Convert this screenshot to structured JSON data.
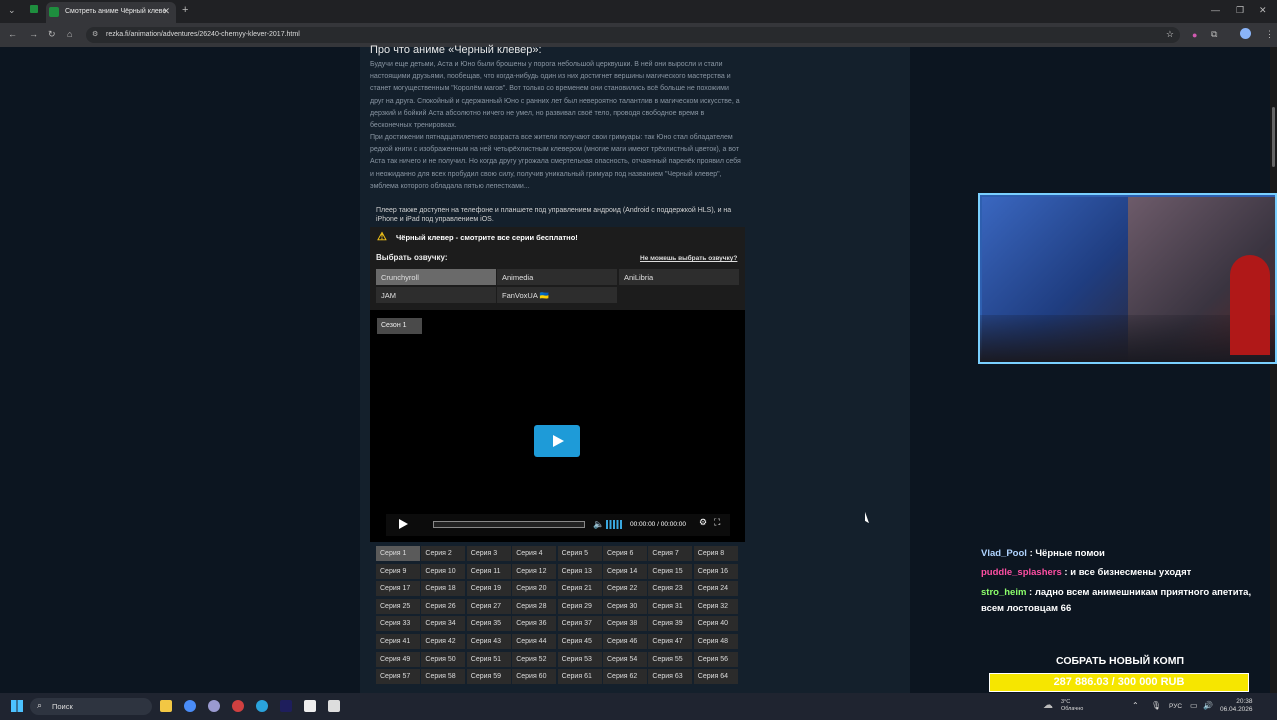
{
  "browser": {
    "tab_title": "Смотреть аниме Чёрный клеве",
    "url": "rezka.fi/animation/adventures/26240-chernyy-klever-2017.html"
  },
  "page": {
    "heading": "Про что аниме «Черный клевер»:",
    "description_1": "Будучи еще детьми, Аста и Юно были брошены у порога небольшой церквушки. В ней они выросли и стали настоящими друзьями, пообещав, что когда-нибудь один из них достигнет вершины магического мастерства и станет могущественным \"Королём магов\". Вот только со временем они становились всё больше не похожими друг на друга. Спокойный и сдержанный Юно с ранних лет был невероятно талантлив в магическом искусстве, а дерзкий и бойкий Аста абсолютно ничего не умел, но развивал своё тело, проводя свободное время в бесконечных тренировках.",
    "description_2": "При достижении пятнадцатилетнего возраста все жители получают свои гримуары: так Юно стал обладателем редкой книги с изображенным на ней четырёхлистным клевером (многие маги имеют трёхлистный цветок), а вот Аста так ничего и не получил. Но когда другу угрожала смертельная опасность, отчаянный паренёк проявил себя и неожиданно для всех пробудил свою силу, получив уникальный гримуар под названием \"Черный клевер\", эмблема которого обладала пятью лепестками...",
    "notice": "Плеер также доступен на телефоне и планшете под управлением андроид (Android с поддержкой HLS), и на iPhone и iPad под управлением iOS.",
    "warning": "Чёрный клевер - смотрите все серии бесплатно!",
    "voice_label": "Выбрать озвучку:",
    "voice_help": "Не можешь выбрать озвучку?",
    "voices": [
      "Crunchyroll",
      "Animedia",
      "AniLibria",
      "JAM",
      "FanVoxUA 🇺🇦"
    ],
    "season": "Сезон 1",
    "time": "00:00:00 / 00:00:00",
    "episodes": [
      "Серия 1",
      "Серия 2",
      "Серия 3",
      "Серия 4",
      "Серия 5",
      "Серия 6",
      "Серия 7",
      "Серия 8",
      "Серия 9",
      "Серия 10",
      "Серия 11",
      "Серия 12",
      "Серия 13",
      "Серия 14",
      "Серия 15",
      "Серия 16",
      "Серия 17",
      "Серия 18",
      "Серия 19",
      "Серия 20",
      "Серия 21",
      "Серия 22",
      "Серия 23",
      "Серия 24",
      "Серия 25",
      "Серия 26",
      "Серия 27",
      "Серия 28",
      "Серия 29",
      "Серия 30",
      "Серия 31",
      "Серия 32",
      "Серия 33",
      "Серия 34",
      "Серия 35",
      "Серия 36",
      "Серия 37",
      "Серия 38",
      "Серия 39",
      "Серия 40",
      "Серия 41",
      "Серия 42",
      "Серия 43",
      "Серия 44",
      "Серия 45",
      "Серия 46",
      "Серия 47",
      "Серия 48",
      "Серия 49",
      "Серия 50",
      "Серия 51",
      "Серия 52",
      "Серия 53",
      "Серия 54",
      "Серия 55",
      "Серия 56",
      "Серия 57",
      "Серия 58",
      "Серия 59",
      "Серия 60",
      "Серия 61",
      "Серия 62",
      "Серия 63",
      "Серия 64"
    ]
  },
  "stream": {
    "chat": [
      {
        "user": "Vlad_Pool",
        "user_color": "#b0d4ff",
        "text": " : Чёрные помои"
      },
      {
        "user": "puddle_splashers",
        "user_color": "#ff4fa3",
        "text": " : и все бизнесмены уходят"
      },
      {
        "user": "stro_heim",
        "user_color": "#8cff6b",
        "text": " : ладно всем анимешникам приятного апетита,"
      },
      {
        "user": "",
        "user_color": "#ffffff",
        "text": "всем лостовцам 66"
      }
    ],
    "donate_title": "СОБРАТЬ НОВЫЙ КОМП",
    "donate_progress": "287 886.03 / 300 000 RUB",
    "donate_fraction": 0.96
  },
  "taskbar": {
    "search": "Поиск",
    "weather_temp": "3°C",
    "weather_text": "Облачно",
    "lang": "РУС",
    "time": "20:38",
    "date": "06.04.2026"
  }
}
